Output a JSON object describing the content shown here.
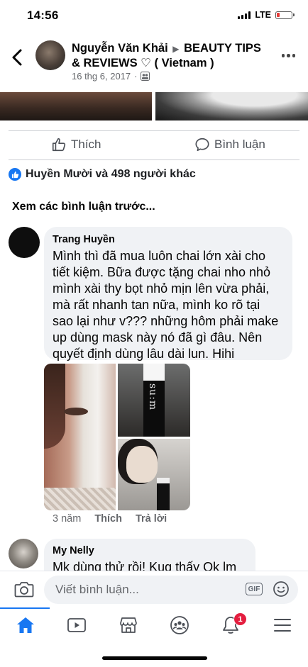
{
  "status_bar": {
    "time": "14:56",
    "network": "LTE",
    "battery_level": 0.2
  },
  "header": {
    "author": "Nguyễn Văn Khải",
    "group": "BEAUTY TIPS & REVIEWS ♡ ( Vietnam )",
    "date": "16 thg 6, 2017",
    "icons": {
      "back": "chevron-left-icon",
      "more": "more-icon",
      "privacy": "group-icon"
    }
  },
  "actions": {
    "like_label": "Thích",
    "comment_label": "Bình luận"
  },
  "reactions": {
    "text": "Huyền Mười và 498 người khác"
  },
  "prev_comments_label": "Xem các bình luận trước...",
  "comments": [
    {
      "name": "Trang Huyền",
      "text": "Mình thì đã mua luôn chai lớn xài cho tiết kiệm. Bữa được tặng chai nho nhỏ mình xài thy bọt nhỏ mịn lên vừa phải, mà rất nhanh tan nữa, mình ko rõ tại sao lại như v??? những hôm phải make up dùng mask này nó đã gì đâu. Nên quyết định dùng lâu dài lun.  Hihi",
      "media_text": "su:m",
      "time": "3 năm",
      "like_label": "Thích",
      "reply_label": "Trả lời"
    },
    {
      "name": "My Nelly",
      "text": "Mk dùng thử rồi! Kug thấy Ok lm"
    }
  ],
  "composer": {
    "placeholder": "Viết bình luận...",
    "gif_label": "GIF"
  },
  "tabbar": {
    "items": [
      "home-icon",
      "video-icon",
      "marketplace-icon",
      "groups-icon",
      "notifications-icon",
      "menu-icon"
    ],
    "active": "home-icon",
    "notification_count": "1"
  },
  "colors": {
    "accent": "#1877f2",
    "badge": "#e41e3f",
    "bubble": "#f0f2f5",
    "muted": "#65676b"
  }
}
